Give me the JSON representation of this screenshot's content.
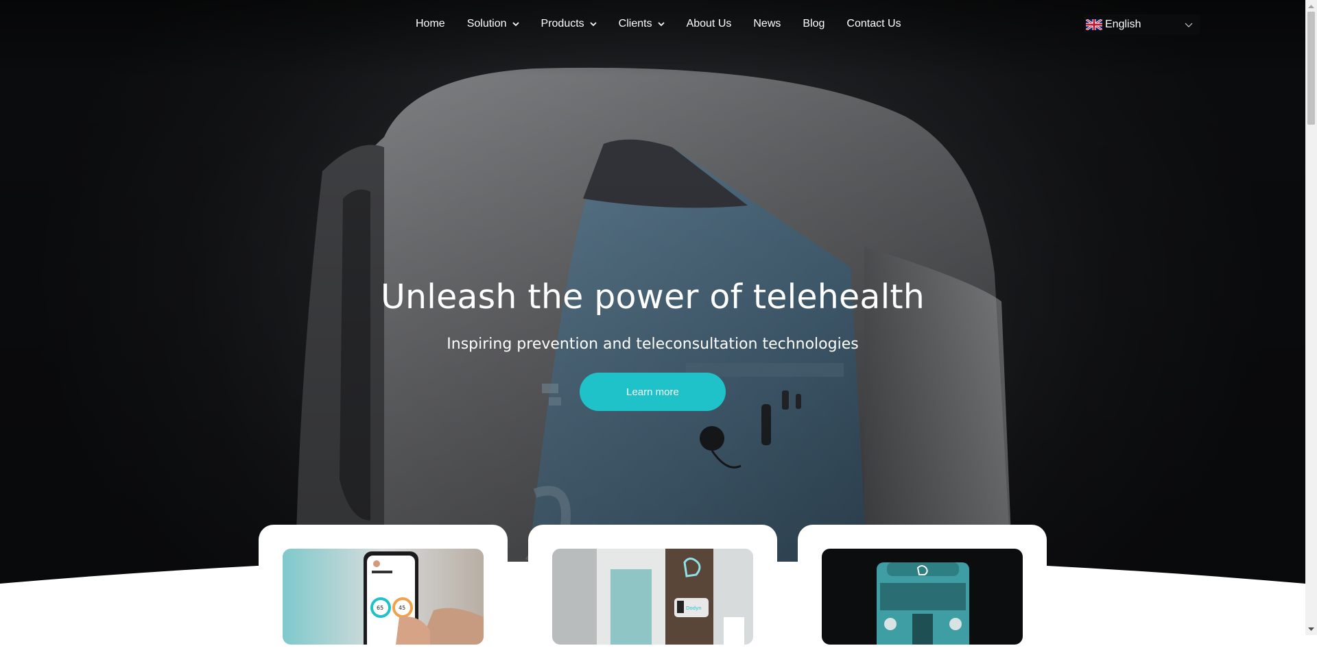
{
  "nav": {
    "items": [
      {
        "label": "Home",
        "dropdown": false
      },
      {
        "label": "Solution",
        "dropdown": true
      },
      {
        "label": "Products",
        "dropdown": true
      },
      {
        "label": "Clients",
        "dropdown": true
      },
      {
        "label": "About Us",
        "dropdown": false
      },
      {
        "label": "News",
        "dropdown": false
      },
      {
        "label": "Blog",
        "dropdown": false
      },
      {
        "label": "Contact Us",
        "dropdown": false
      }
    ],
    "language": {
      "label": "English",
      "flag_icon": "uk-flag-icon"
    }
  },
  "hero": {
    "title": "Unleash the power of telehealth",
    "subtitle": "Inspiring prevention and teleconsultation technologies",
    "cta_label": "Learn more"
  },
  "cards": [
    {
      "image": "mobile-app-photo"
    },
    {
      "image": "health-booth-photo"
    },
    {
      "image": "mobile-clinic-truck-photo"
    }
  ],
  "colors": {
    "accent": "#1fc2c8",
    "hero_dark": "#141517",
    "text_light": "#ffffff"
  }
}
